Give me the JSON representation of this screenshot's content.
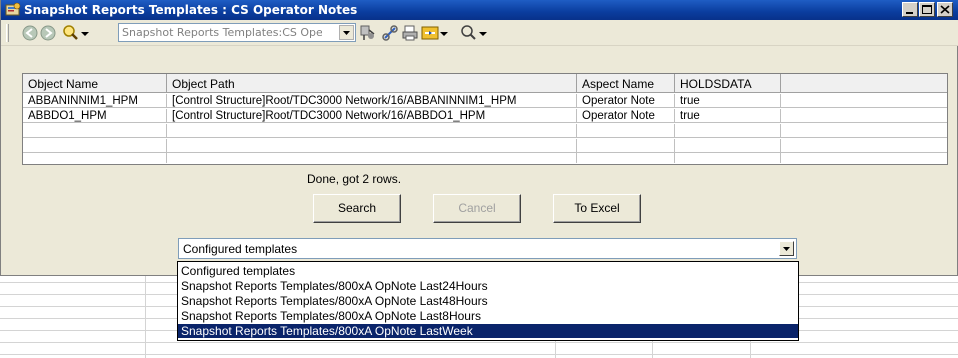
{
  "window": {
    "title": "Snapshot Reports Templates : CS Operator Notes",
    "icon": "snapshot-reports-icon",
    "controls": [
      "minimize",
      "maximize",
      "close"
    ]
  },
  "toolbar": {
    "icons": [
      "back-icon",
      "forward-icon",
      "search-icon",
      "dropdown-arrow-icon",
      "pin-icon",
      "link-icon",
      "print-icon",
      "view-icon",
      "zoom-icon"
    ],
    "combo_value": "Snapshot Reports Templates:CS Ope"
  },
  "table": {
    "columns": [
      "Object Name",
      "Object Path",
      "Aspect Name",
      "HOLDSDATA",
      ""
    ],
    "rows": [
      [
        "ABBANINNIM1_HPM",
        "[Control Structure]Root/TDC3000 Network/16/ABBANINNIM1_HPM",
        "Operator Note",
        "true",
        ""
      ],
      [
        "ABBDO1_HPM",
        "[Control Structure]Root/TDC3000 Network/16/ABBDO1_HPM",
        "Operator Note",
        "true",
        ""
      ],
      [
        "",
        "",
        "",
        "",
        ""
      ],
      [
        "",
        "",
        "",
        "",
        ""
      ],
      [
        "",
        "",
        "",
        "",
        ""
      ]
    ]
  },
  "status_text": "Done, got 2 rows.",
  "buttons": {
    "search": "Search",
    "cancel": "Cancel",
    "to_excel": "To Excel"
  },
  "template_select": {
    "value": "Configured templates",
    "options": [
      "Configured templates",
      "Snapshot Reports Templates/800xA OpNote Last24Hours",
      "Snapshot Reports Templates/800xA OpNote Last48Hours",
      "Snapshot Reports Templates/800xA OpNote Last8Hours",
      "Snapshot Reports Templates/800xA OpNote LastWeek"
    ],
    "highlighted_index": 4
  },
  "colors": {
    "titlebar": "#0a3d9e",
    "window_bg": "#ece9d8",
    "selection": "#0a246a"
  }
}
